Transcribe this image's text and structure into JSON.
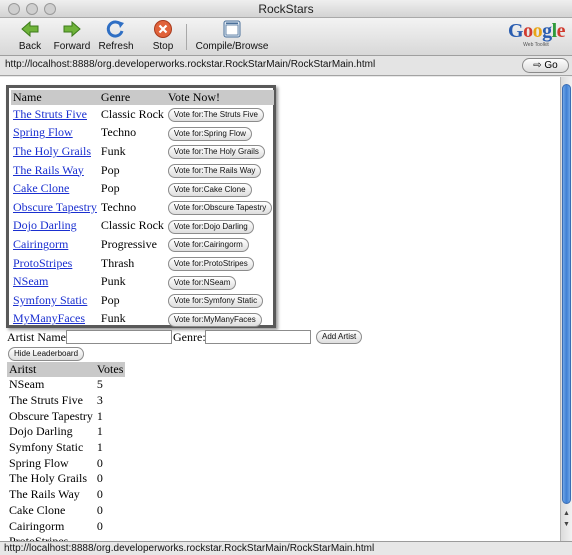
{
  "window": {
    "title": "RockStars"
  },
  "toolbar": {
    "back_label": "Back",
    "forward_label": "Forward",
    "refresh_label": "Refresh",
    "stop_label": "Stop",
    "compile_label": "Compile/Browse"
  },
  "logo": {
    "word": [
      "G",
      "o",
      "o",
      "g",
      "l",
      "e"
    ],
    "sub": "Web Toolkit"
  },
  "address": {
    "url": "http://localhost:8888/org.developerworks.rockstar.RockStarMain/RockStarMain.html",
    "go_label": "Go"
  },
  "vote_table": {
    "headers": [
      "Name",
      "Genre",
      "Vote Now!"
    ],
    "rows": [
      {
        "name": "The Struts Five",
        "genre": "Classic Rock",
        "vote": "Vote for:The Struts Five"
      },
      {
        "name": "Spring Flow",
        "genre": "Techno",
        "vote": "Vote for:Spring Flow"
      },
      {
        "name": "The Holy Grails",
        "genre": "Funk",
        "vote": "Vote for:The Holy Grails"
      },
      {
        "name": "The Rails Way",
        "genre": "Pop",
        "vote": "Vote for:The Rails Way"
      },
      {
        "name": "Cake Clone",
        "genre": "Pop",
        "vote": "Vote for:Cake Clone"
      },
      {
        "name": "Obscure Tapestry",
        "genre": "Techno",
        "vote": "Vote for:Obscure Tapestry"
      },
      {
        "name": "Dojo Darling",
        "genre": "Classic Rock",
        "vote": "Vote for:Dojo Darling"
      },
      {
        "name": "Cairingorm",
        "genre": "Progressive",
        "vote": "Vote for:Cairingorm"
      },
      {
        "name": "ProtoStripes",
        "genre": "Thrash",
        "vote": "Vote for:ProtoStripes"
      },
      {
        "name": "NSeam",
        "genre": "Punk",
        "vote": "Vote for:NSeam"
      },
      {
        "name": "Symfony Static",
        "genre": "Pop",
        "vote": "Vote for:Symfony Static"
      },
      {
        "name": "MyManyFaces",
        "genre": "Funk",
        "vote": "Vote for:MyManyFaces"
      }
    ]
  },
  "add_form": {
    "artist_label": "Artist Name:",
    "artist_value": "",
    "genre_label": "Genre:",
    "genre_value": "",
    "add_label": "Add Artist"
  },
  "leaderboard": {
    "toggle_label": "Hide Leaderboard",
    "headers": [
      "Aritst",
      "Votes"
    ],
    "rows": [
      {
        "artist": "NSeam",
        "votes": "5"
      },
      {
        "artist": "The Struts Five",
        "votes": "3"
      },
      {
        "artist": "Obscure Tapestry",
        "votes": "1"
      },
      {
        "artist": "Dojo Darling",
        "votes": "1"
      },
      {
        "artist": "Symfony Static",
        "votes": "1"
      },
      {
        "artist": "Spring Flow",
        "votes": "0"
      },
      {
        "artist": "The Holy Grails",
        "votes": "0"
      },
      {
        "artist": "The Rails Way",
        "votes": "0"
      },
      {
        "artist": "Cake Clone",
        "votes": "0"
      },
      {
        "artist": "Cairingorm",
        "votes": "0"
      },
      {
        "artist": "ProtoStripes",
        "votes": ""
      }
    ]
  },
  "status": {
    "text": "http://localhost:8888/org.developerworks.rockstar.RockStarMain/RockStarMain.html"
  },
  "colors": {
    "link": "#1a2fd0",
    "header_bg": "#c9c9c9",
    "scroll_thumb": "#3e7fd4"
  }
}
